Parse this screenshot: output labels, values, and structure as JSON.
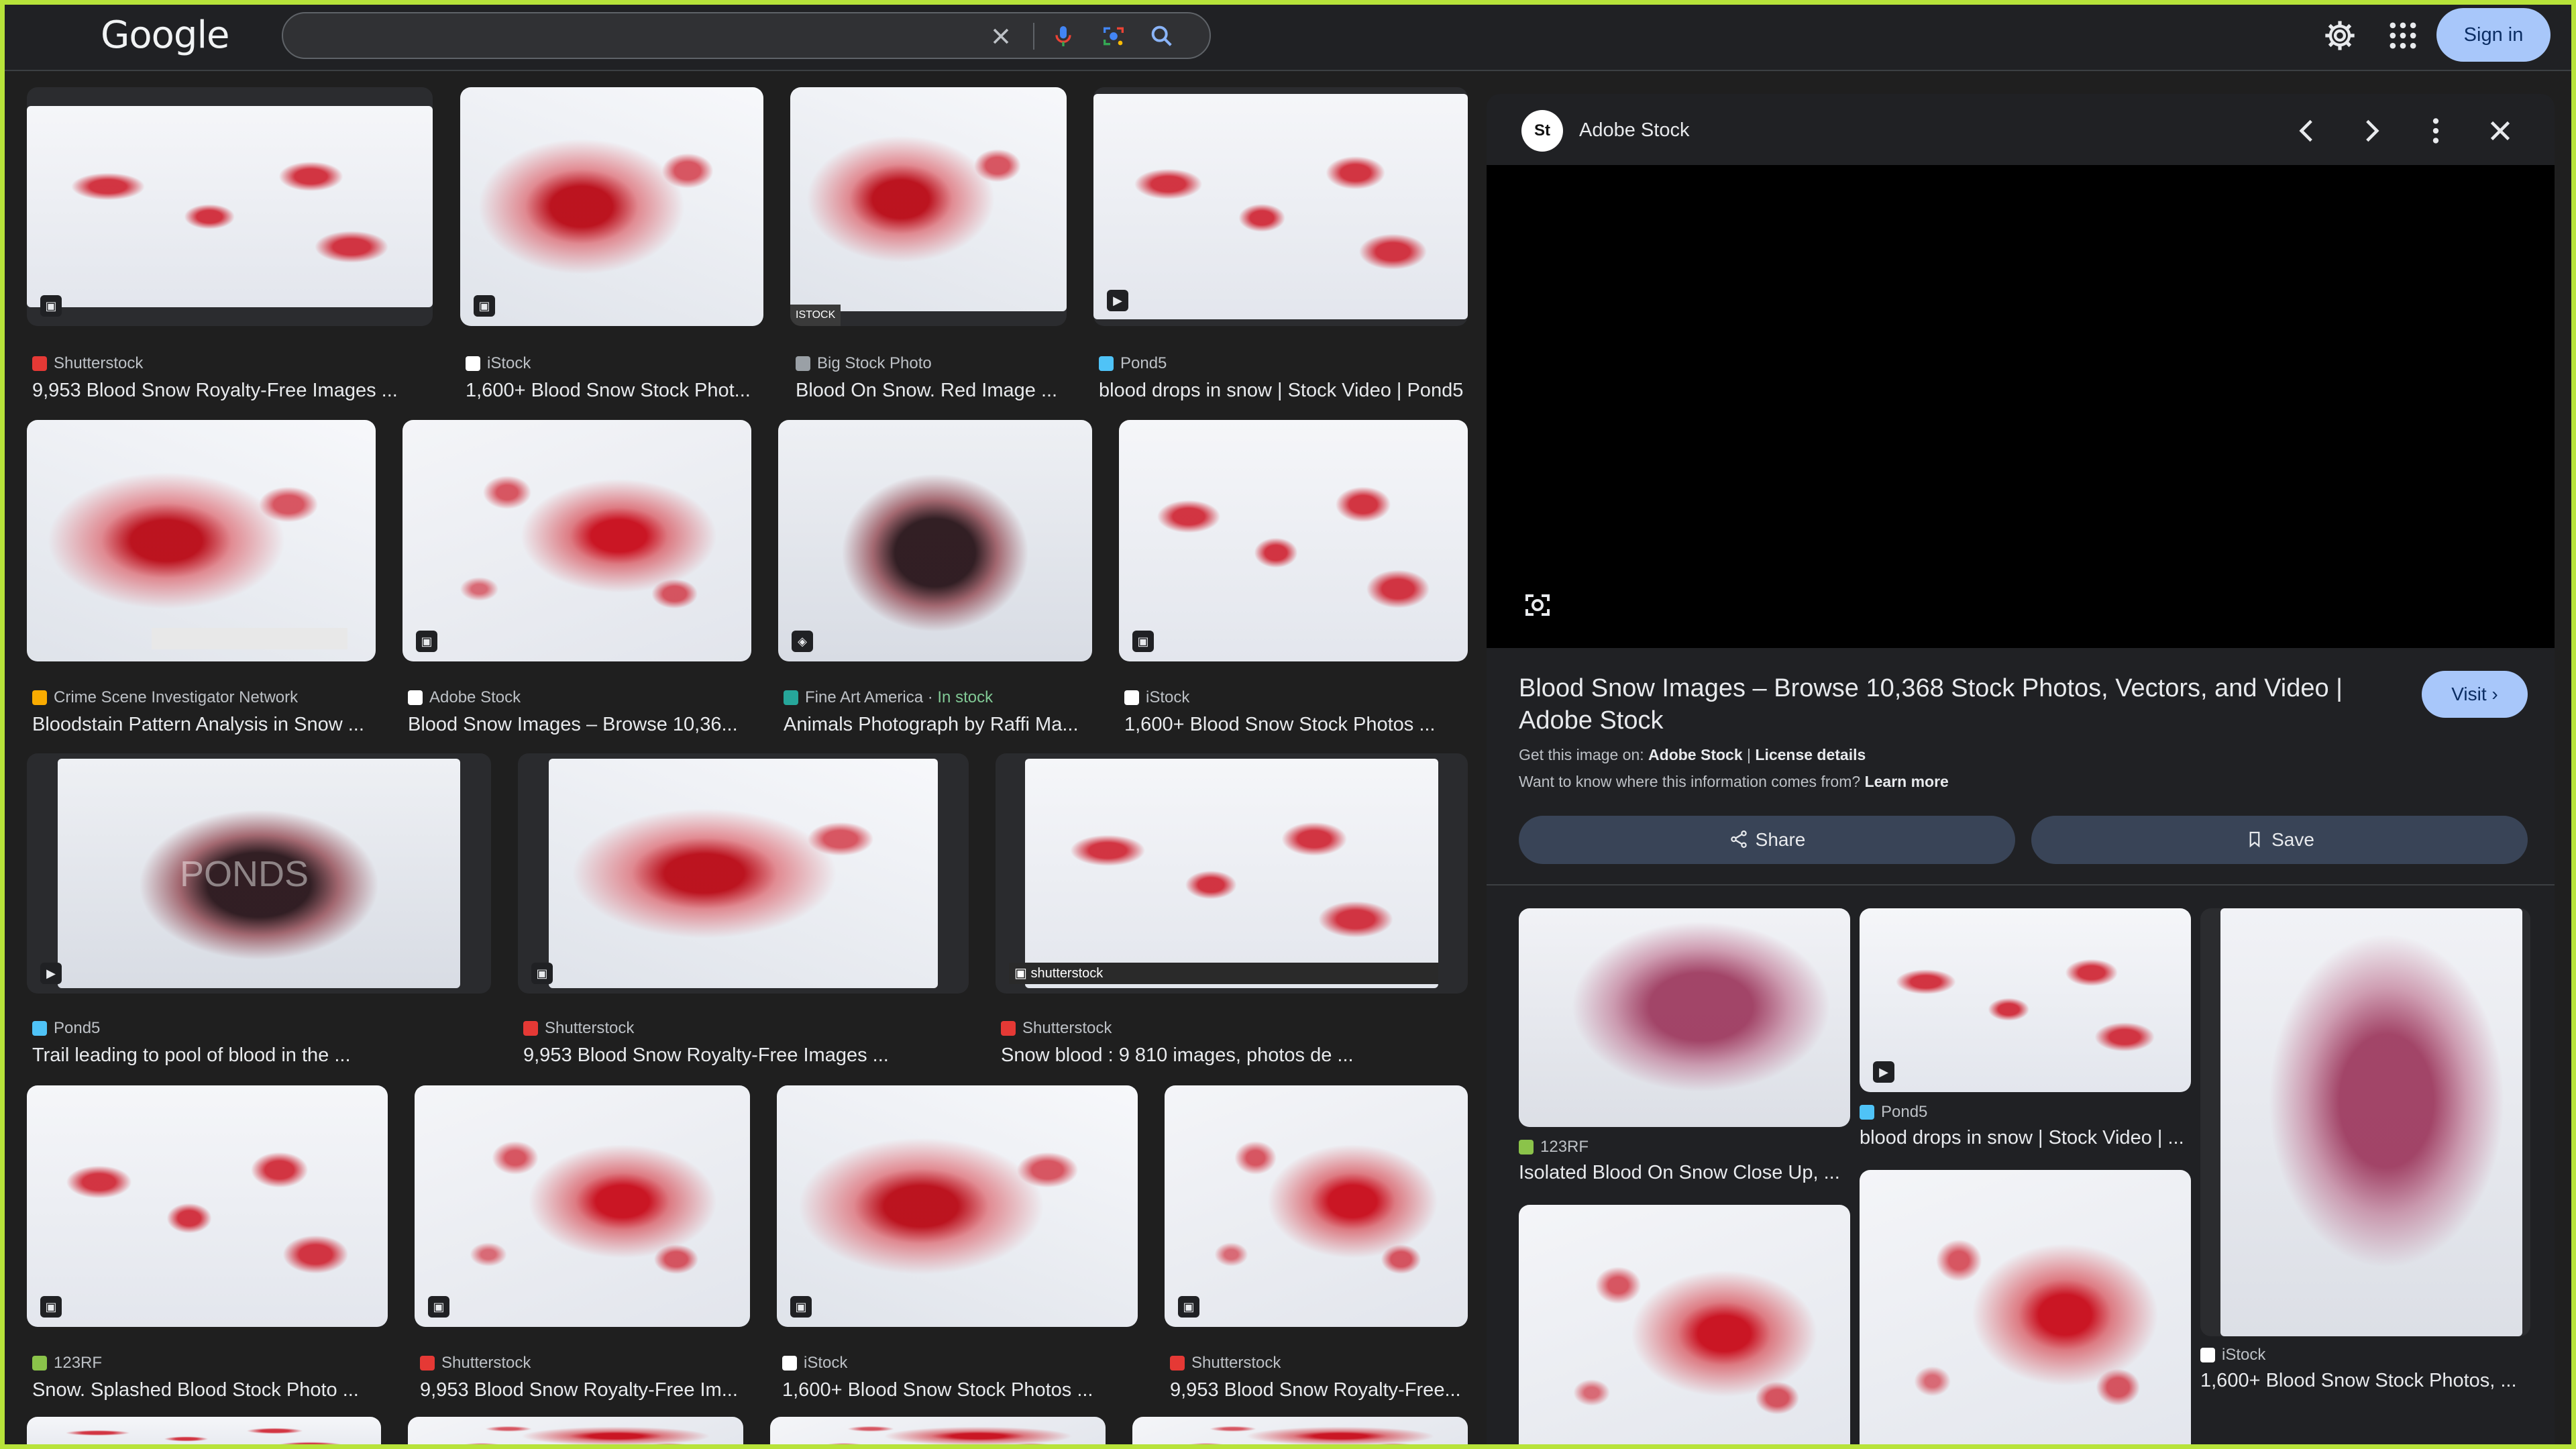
{
  "header": {
    "logo": "Google",
    "search_value": "",
    "signin_label": "Sign in",
    "icons": {
      "clear": "close-icon",
      "voice": "mic-icon",
      "lens": "camera-lens-icon",
      "search": "search-icon",
      "settings": "gear-icon",
      "apps": "apps-grid-icon"
    }
  },
  "results": [
    {
      "source": "Shutterstock",
      "title": "9,953 Blood Snow Royalty-Free Images ...",
      "badge": "image-icon"
    },
    {
      "source": "iStock",
      "title": "1,600+ Blood Snow Stock Phot...",
      "badge": "image-icon"
    },
    {
      "source": "Big Stock Photo",
      "title": "Blood On Snow. Red Image ...",
      "watermark": "ISTOCK"
    },
    {
      "source": "Pond5",
      "title": "blood drops in snow | Stock Video | Pond5",
      "badge": "play-icon"
    },
    {
      "source": "Crime Scene Investigator Network",
      "title": "Bloodstain Pattern Analysis in Snow ..."
    },
    {
      "source": "Adobe Stock",
      "title": "Blood Snow Images – Browse 10,36...",
      "badge": "image-icon"
    },
    {
      "source": "Fine Art America",
      "stock": "In stock",
      "title": "Animals Photograph by Raffi Ma...",
      "badge": "tag-icon"
    },
    {
      "source": "iStock",
      "title": "1,600+ Blood Snow Stock Photos ...",
      "badge": "image-icon"
    },
    {
      "source": "Pond5",
      "title": "Trail leading to pool of blood in the ...",
      "badge": "play-icon",
      "watermark": "PONDS"
    },
    {
      "source": "Shutterstock",
      "title": "9,953 Blood Snow Royalty-Free Images ...",
      "badge": "image-icon"
    },
    {
      "source": "Shutterstock",
      "title": "Snow blood : 9 810 images, photos de ...",
      "badge": "image-icon",
      "watermark": "shutterstock"
    },
    {
      "source": "123RF",
      "title": "Snow. Splashed Blood Stock Photo ...",
      "badge": "image-icon"
    },
    {
      "source": "Shutterstock",
      "title": "9,953 Blood Snow Royalty-Free Im...",
      "badge": "image-icon"
    },
    {
      "source": "iStock",
      "title": "1,600+ Blood Snow Stock Photos ...",
      "badge": "image-icon"
    },
    {
      "source": "Shutterstock",
      "title": "9,953 Blood Snow Royalty-Free...",
      "badge": "image-icon"
    }
  ],
  "panel": {
    "source": "Adobe Stock",
    "logo_text": "St",
    "title": "Blood Snow Images – Browse 10,368 Stock Photos, Vectors, and Video | Adobe Stock",
    "visit_label": "Visit",
    "get_image_prefix": "Get this image on:",
    "get_image_source": "Adobe Stock",
    "separator": "|",
    "license_label": "License details",
    "info_question": "Want to know where this information comes from?",
    "learn_more": "Learn more",
    "share_label": "Share",
    "save_label": "Save",
    "related": [
      {
        "source": "123RF",
        "title": "Isolated Blood On Snow Close Up, ..."
      },
      {
        "source": "Pond5",
        "title": "blood drops in snow | Stock Video | ..."
      },
      {
        "source": "iStock",
        "title": "1,600+ Blood Snow Stock Photos, ..."
      }
    ]
  },
  "colors": {
    "accent": "#a8c7fa",
    "frame": "#b7e33a",
    "background": "#1f1f1f",
    "action_button": "#394457"
  }
}
